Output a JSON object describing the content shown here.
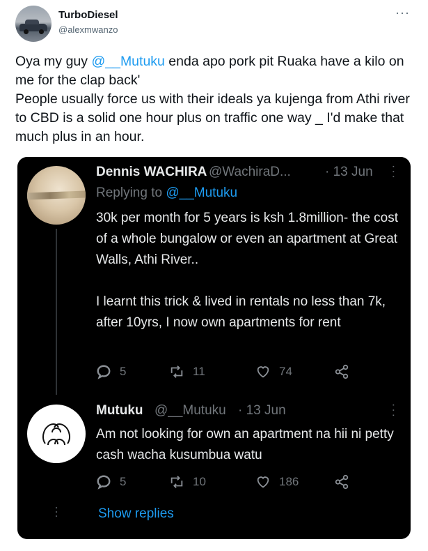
{
  "tweet": {
    "author_name": "TurboDiesel",
    "author_handle": "@alexmwanzo",
    "more_icon": "ellipsis-horizontal-icon",
    "text_parts": [
      "Oya my guy ",
      "@__Mutuku",
      " enda apo pork pit  Ruaka have a kilo on me for the clap back'",
      "People usually force us with  their ideals ya kujenga from Athi river to CBD is a solid one hour plus on traffic one way _ I'd make that much plus in an hour."
    ]
  },
  "quoted_thread": {
    "reply1": {
      "name": "Dennis WACHIRA",
      "handle": "@WachiraD...",
      "date": "· 13 Jun",
      "replying_to_label": "Replying to ",
      "replying_to_handle": "@__Mutuku",
      "paragraph1": "30k per month for 5 years is ksh 1.8million- the cost of a whole bungalow or even an apartment at Great Walls, Athi River..",
      "paragraph2": "I learnt this trick & lived in rentals no less than 7k, after 10yrs, I now own apartments for rent",
      "replies": "5",
      "retweets": "11",
      "likes": "74"
    },
    "reply2": {
      "name": "Mutuku",
      "handle": "@__Mutuku",
      "date": "· 13 Jun",
      "text": "Am not looking for own an apartment na hii ni petty cash wacha kusumbua watu",
      "replies": "5",
      "retweets": "10",
      "likes": "186"
    },
    "show_replies": "Show replies"
  },
  "colors": {
    "link": "#1d9bf0",
    "dark_bg": "#000000",
    "muted": "#71767b"
  }
}
